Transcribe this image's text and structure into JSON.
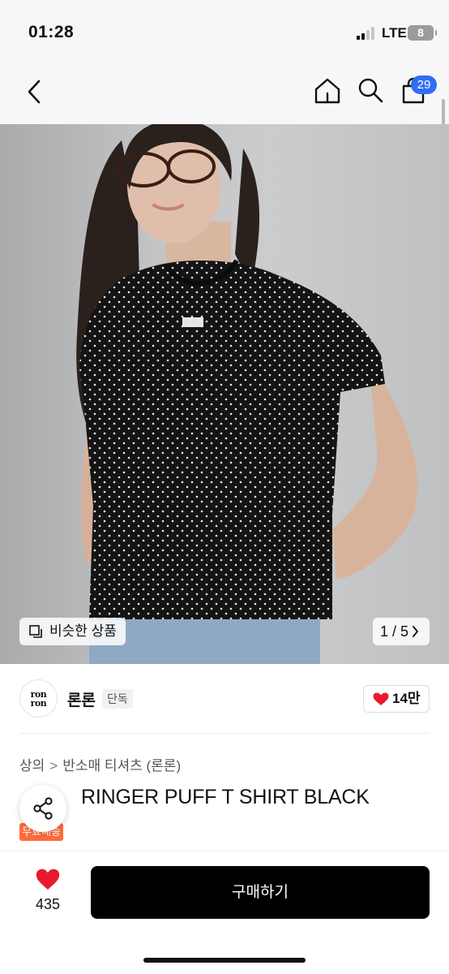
{
  "status_bar": {
    "time": "01:28",
    "carrier": "LTE",
    "battery": "8"
  },
  "nav": {
    "back_icon": "chevron-left-icon",
    "home_icon": "home-icon",
    "search_icon": "search-icon",
    "cart_icon": "shopping-bag-icon",
    "cart_count": "29"
  },
  "gallery": {
    "similar_label": "비슷한 상품",
    "pager": "1 / 5"
  },
  "brand": {
    "logo_line1": "ron",
    "logo_line2": "ron",
    "name": "론론",
    "badge": "단독",
    "likes": "14만"
  },
  "breadcrumb": {
    "category": "상의",
    "subcategory": "반소매 티셔츠 (론론)"
  },
  "product": {
    "title": "RINGER PUFF T SHIRT BLACK",
    "free_shipping_badge": "무료배송"
  },
  "bottom_bar": {
    "wish_count": "435",
    "buy_label": "구매하기"
  },
  "colors": {
    "accent_badge": "#2f6df6",
    "like_red": "#e8192c",
    "free_ship": "#ff6b3d",
    "buy_button": "#000000"
  }
}
